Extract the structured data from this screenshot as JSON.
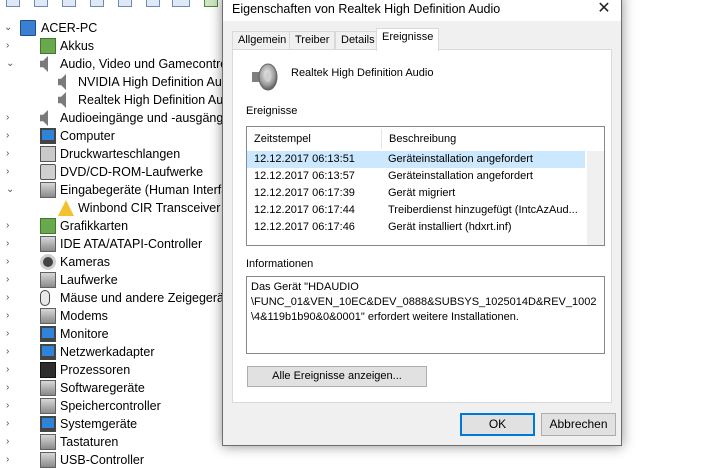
{
  "tree": {
    "root": "ACER-PC",
    "items": [
      {
        "label": "Akkus",
        "icon": "battery-icon",
        "arrow": "›",
        "indent": 1
      },
      {
        "label": "Audio, Video und Gamecontroller",
        "icon": "speaker-icon",
        "arrow": "⌄",
        "indent": 1
      },
      {
        "label": "NVIDIA High Definition Audio",
        "icon": "speaker-icon",
        "arrow": "",
        "indent": 2
      },
      {
        "label": "Realtek High Definition Audio",
        "icon": "speaker-icon",
        "arrow": "",
        "indent": 2
      },
      {
        "label": "Audioeingänge und -ausgänge",
        "icon": "speaker-icon",
        "arrow": "›",
        "indent": 1
      },
      {
        "label": "Computer",
        "icon": "monitor-icon",
        "arrow": "›",
        "indent": 1
      },
      {
        "label": "Druckwarteschlangen",
        "icon": "printer-icon",
        "arrow": "›",
        "indent": 1
      },
      {
        "label": "DVD/CD-ROM-Laufwerke",
        "icon": "disc-drive-icon",
        "arrow": "›",
        "indent": 1
      },
      {
        "label": "Eingabegeräte (Human Interface Devices)",
        "icon": "hid-icon",
        "arrow": "⌄",
        "indent": 1
      },
      {
        "label": "Winbond CIR Transceiver",
        "icon": "warning-device-icon",
        "arrow": "",
        "indent": 2
      },
      {
        "label": "Grafikkarten",
        "icon": "graphics-card-icon",
        "arrow": "›",
        "indent": 1
      },
      {
        "label": "IDE ATA/ATAPI-Controller",
        "icon": "ide-controller-icon",
        "arrow": "›",
        "indent": 1
      },
      {
        "label": "Kameras",
        "icon": "camera-icon",
        "arrow": "›",
        "indent": 1
      },
      {
        "label": "Laufwerke",
        "icon": "disk-drive-icon",
        "arrow": "›",
        "indent": 1
      },
      {
        "label": "Mäuse und andere Zeigegeräte",
        "icon": "mouse-icon",
        "arrow": "›",
        "indent": 1
      },
      {
        "label": "Modems",
        "icon": "modem-icon",
        "arrow": "›",
        "indent": 1
      },
      {
        "label": "Monitore",
        "icon": "monitor-icon",
        "arrow": "›",
        "indent": 1
      },
      {
        "label": "Netzwerkadapter",
        "icon": "network-adapter-icon",
        "arrow": "›",
        "indent": 1
      },
      {
        "label": "Prozessoren",
        "icon": "processor-icon",
        "arrow": "›",
        "indent": 1
      },
      {
        "label": "Softwaregeräte",
        "icon": "software-device-icon",
        "arrow": "›",
        "indent": 1
      },
      {
        "label": "Speichercontroller",
        "icon": "storage-controller-icon",
        "arrow": "›",
        "indent": 1
      },
      {
        "label": "Systemgeräte",
        "icon": "system-device-icon",
        "arrow": "›",
        "indent": 1
      },
      {
        "label": "Tastaturen",
        "icon": "keyboard-icon",
        "arrow": "›",
        "indent": 1
      },
      {
        "label": "USB-Controller",
        "icon": "usb-icon",
        "arrow": "›",
        "indent": 1
      }
    ]
  },
  "dialog": {
    "title": "Eigenschaften von Realtek High Definition Audio",
    "close_glyph": "✕",
    "tabs": [
      {
        "label": "Allgemein"
      },
      {
        "label": "Treiber"
      },
      {
        "label": "Details"
      },
      {
        "label": "Ereignisse"
      }
    ],
    "device_name": "Realtek High Definition Audio",
    "events_label": "Ereignisse",
    "columns": [
      "Zeitstempel",
      "Beschreibung"
    ],
    "events": [
      {
        "time": "12.12.2017 06:13:51",
        "desc": "Geräteinstallation angefordert"
      },
      {
        "time": "12.12.2017 06:13:57",
        "desc": "Geräteinstallation angefordert"
      },
      {
        "time": "12.12.2017 06:17:39",
        "desc": "Gerät migriert"
      },
      {
        "time": "12.12.2017 06:17:44",
        "desc": "Treiberdienst hinzugefügt (IntcAzAud..."
      },
      {
        "time": "12.12.2017 06:17:46",
        "desc": "Gerät installiert (hdxrt.inf)"
      }
    ],
    "info_label": "Informationen",
    "info_lines": [
      "Das Gerät \"HDAUDIO",
      "\\FUNC_01&VEN_10EC&DEV_0888&SUBSYS_1025014D&REV_1002",
      "\\4&119b1b90&0&0001\" erfordert weitere Installationen."
    ],
    "all_events_button": "Alle Ereignisse anzeigen...",
    "ok_button": "OK",
    "cancel_button": "Abbrechen"
  },
  "colors": {
    "selection": "#cce8ff",
    "focus_border": "#0078d7",
    "dialog_bg": "#f0f0f0"
  }
}
